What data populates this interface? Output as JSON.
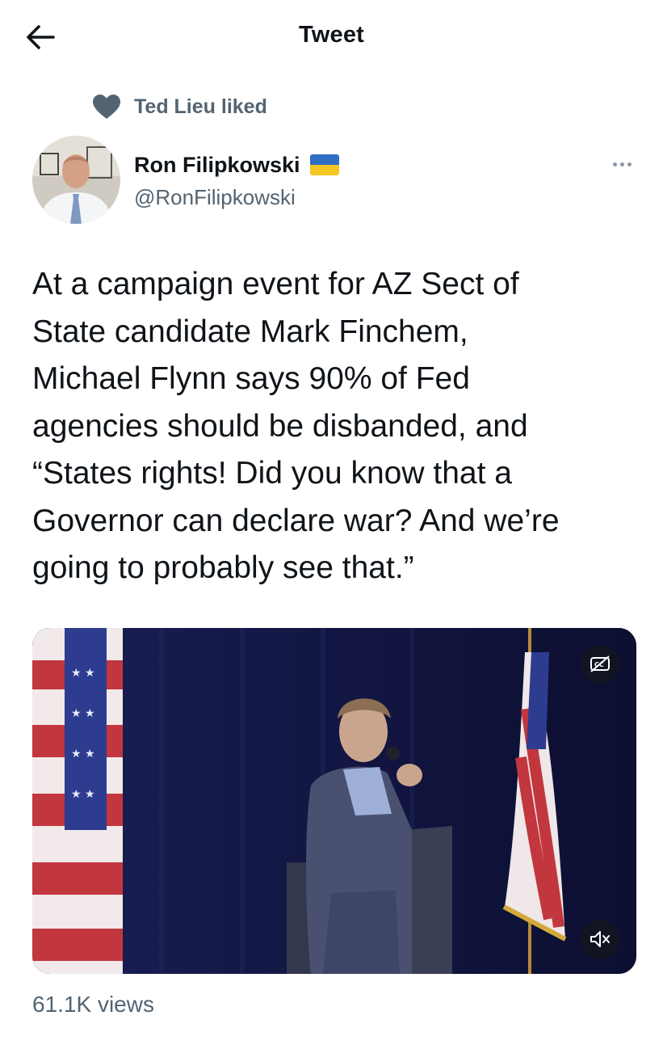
{
  "header": {
    "title": "Tweet"
  },
  "social_context": {
    "text": "Ted Lieu liked"
  },
  "author": {
    "name": "Ron Filipkowski",
    "handle": "@RonFilipkowski",
    "flag_emoji": "Ukraine flag"
  },
  "tweet": {
    "text": "At a campaign event for AZ Sect of\nState candidate Mark Finchem,\nMichael Flynn says 90% of Fed\nagencies should be disbanded, and\n“States rights! Did you know that a\nGovernor can declare war? And we’re\ngoing to probably see that.”"
  },
  "media": {
    "type": "video",
    "controls": {
      "captions_icon": "closed-captions-icon",
      "mute_icon": "muted-speaker-icon"
    }
  },
  "stats": {
    "views": "61.1K views"
  },
  "colors": {
    "text": "#0f1419",
    "secondary": "#536471",
    "background": "#ffffff"
  }
}
